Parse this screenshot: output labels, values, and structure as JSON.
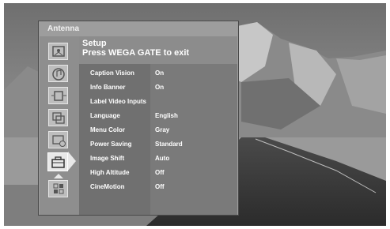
{
  "window": {
    "title": "Antenna"
  },
  "setup": {
    "title": "Setup",
    "subtitle": "Press WEGA GATE to exit"
  },
  "settings": [
    {
      "label": "Caption Vision",
      "value": "On"
    },
    {
      "label": "Info Banner",
      "value": "On"
    },
    {
      "label": "Label Video Inputs",
      "value": ""
    },
    {
      "label": "Language",
      "value": "English"
    },
    {
      "label": "Menu Color",
      "value": "Gray"
    },
    {
      "label": "Power Saving",
      "value": "Standard"
    },
    {
      "label": "Image Shift",
      "value": "Auto"
    },
    {
      "label": "High Altitude",
      "value": "Off"
    },
    {
      "label": "CineMotion",
      "value": "Off"
    }
  ],
  "icons": [
    "picture-icon",
    "sound-icon",
    "screen-icon",
    "channel-icon",
    "timer-icon",
    "setup-icon",
    "apps-icon"
  ],
  "selected_icon": "setup-icon",
  "colors": {
    "menu_bg": "#6a6a6a",
    "title_bar": "#9d9d9d",
    "text": "#ffffff"
  }
}
